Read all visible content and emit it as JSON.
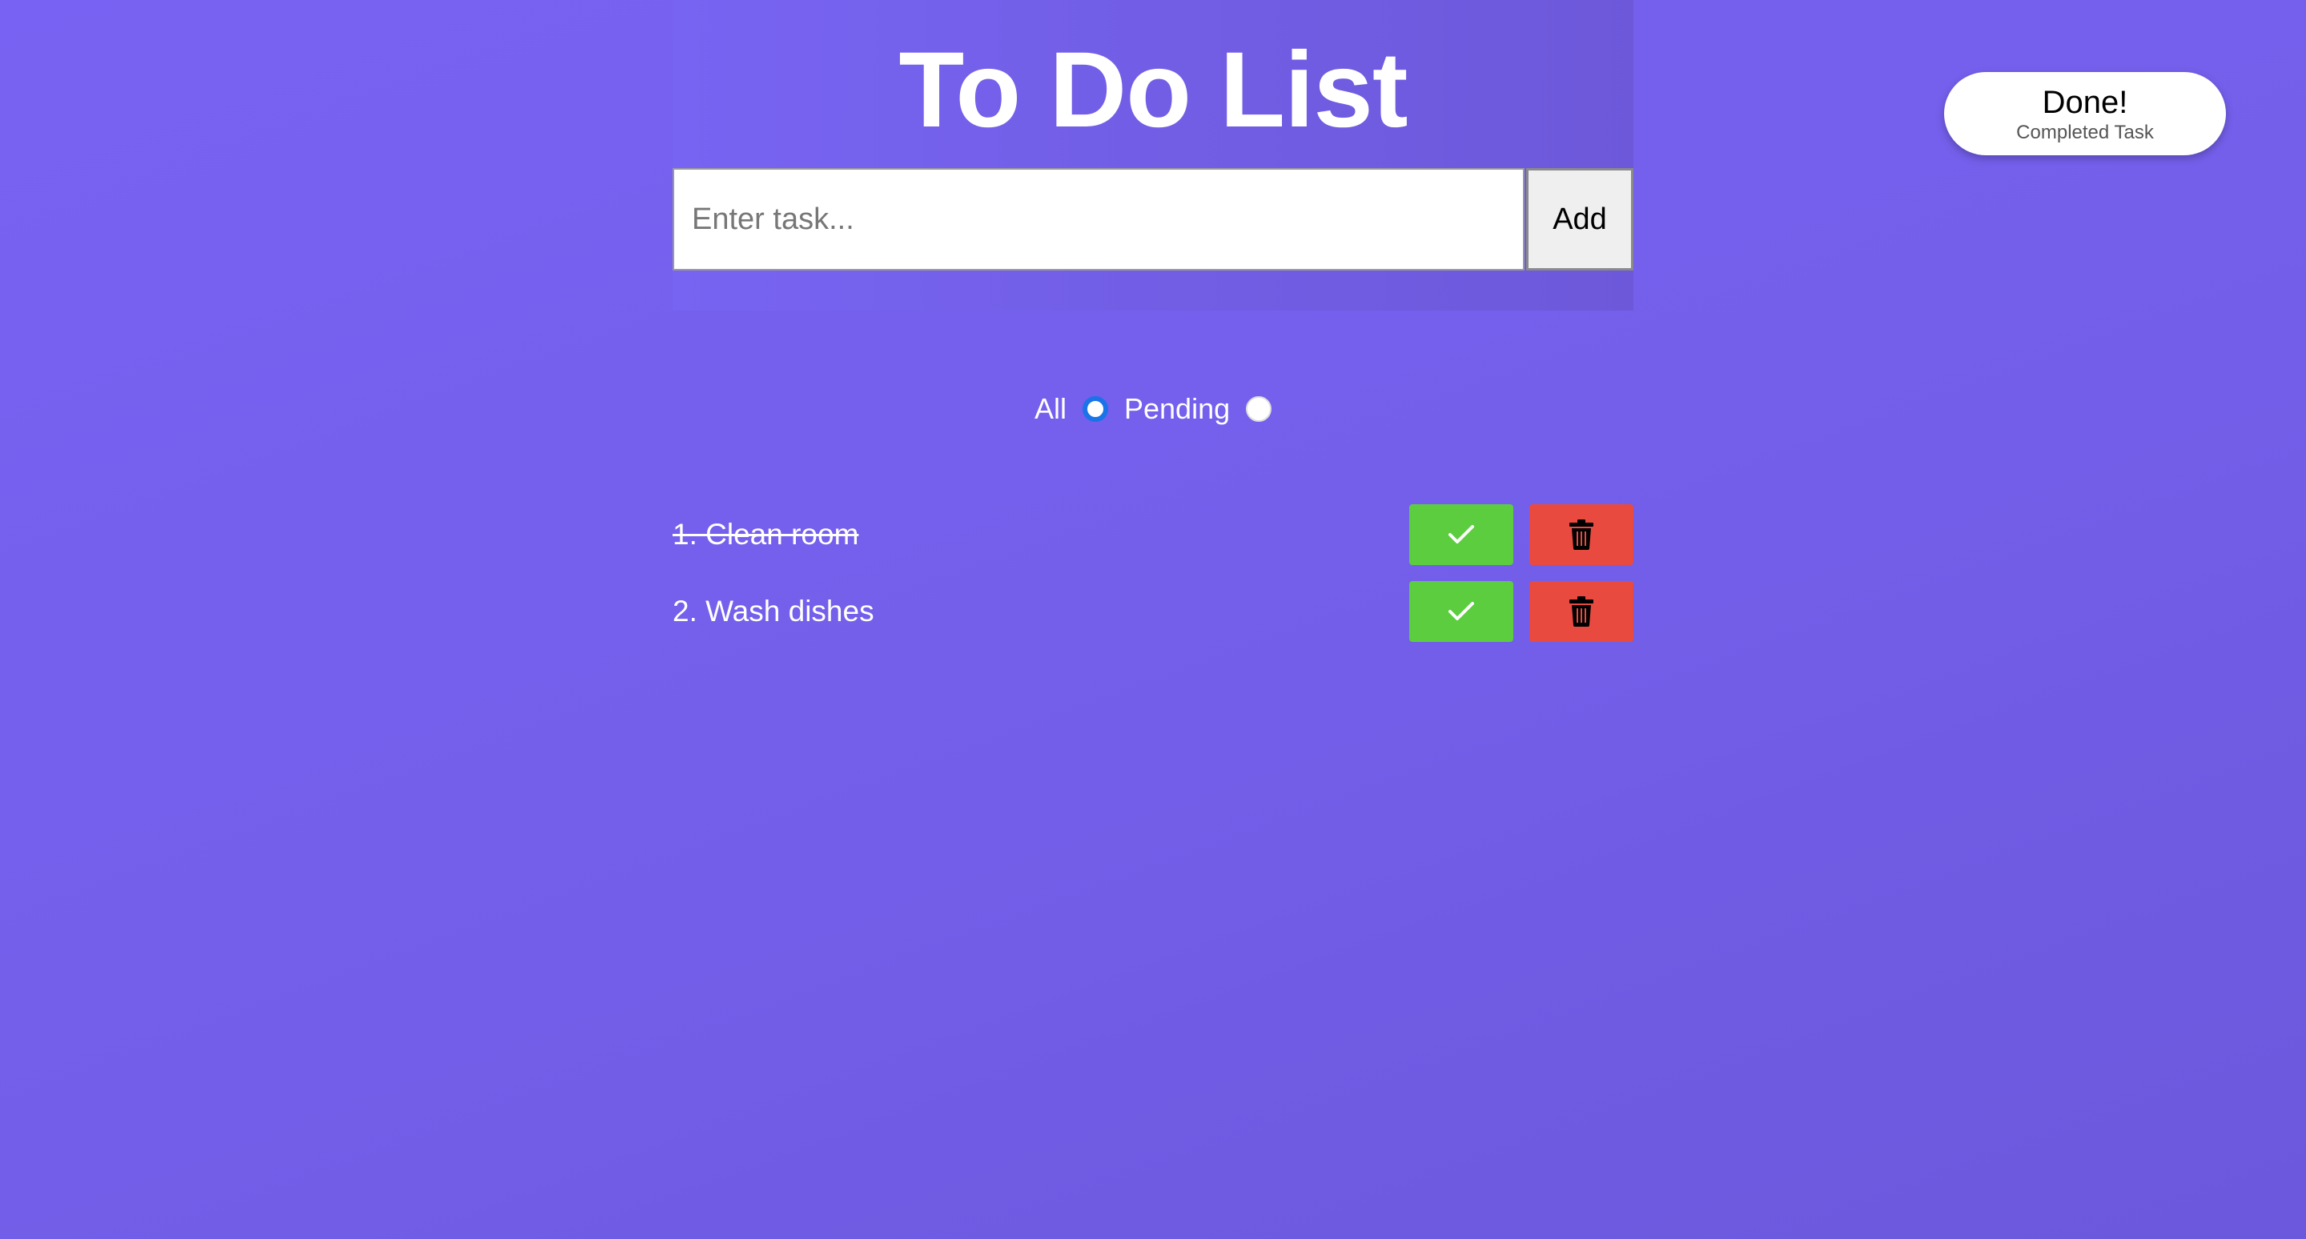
{
  "app": {
    "title": "To Do List"
  },
  "input": {
    "value": "",
    "placeholder": "Enter task..."
  },
  "add_button": {
    "label": "Add"
  },
  "done_pill": {
    "title": "Done!",
    "subtitle": "Completed Task"
  },
  "filters": [
    {
      "label": "All",
      "selected": true
    },
    {
      "label": "Pending",
      "selected": false
    }
  ],
  "tasks": [
    {
      "text": "1. Clean room",
      "completed": true
    },
    {
      "text": "2. Wash dishes",
      "completed": false
    }
  ],
  "icons": {
    "complete": "check-icon",
    "delete": "trash-icon"
  },
  "colors": {
    "background": "#7360ec",
    "complete_button": "#5ccd3f",
    "delete_button": "#e94a40",
    "radio_selected": "#1a73e8"
  }
}
